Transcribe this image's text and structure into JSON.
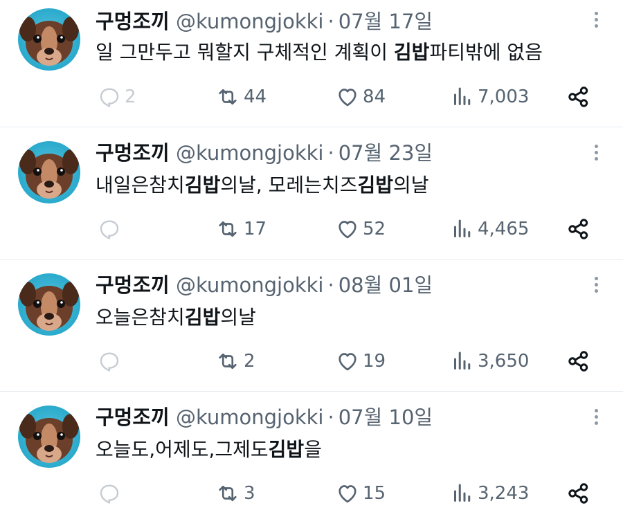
{
  "colors": {
    "text_primary": "#0f1419",
    "text_secondary": "#566370",
    "divider": "#e6ebee",
    "avatar_bg": "#2fb7d9"
  },
  "icons": {
    "reply": "reply-icon",
    "retweet": "retweet-icon",
    "like": "heart-icon",
    "views": "views-icon",
    "share": "share-icon",
    "more": "more-icon"
  },
  "tweets": [
    {
      "name": "구멍조끼",
      "handle": "@kumongjokki",
      "separator": "·",
      "date": "07월 17일",
      "body_before": "일 그만두고 뭐할지 구체적인 계획이 ",
      "body_bold": "김밥",
      "body_after": "파티밖에 없음",
      "replies": "2",
      "retweets": "44",
      "likes": "84",
      "views": "7,003"
    },
    {
      "name": "구멍조끼",
      "handle": "@kumongjokki",
      "separator": "·",
      "date": "07월 23일",
      "body_before": "내일은참치",
      "body_bold": "김밥",
      "body_mid": "의날, 모레는치즈",
      "body_bold2": "김밥",
      "body_after": "의날",
      "replies": "",
      "retweets": "17",
      "likes": "52",
      "views": "4,465"
    },
    {
      "name": "구멍조끼",
      "handle": "@kumongjokki",
      "separator": "·",
      "date": "08월 01일",
      "body_before": "오늘은참치",
      "body_bold": "김밥",
      "body_after": "의날",
      "replies": "",
      "retweets": "2",
      "likes": "19",
      "views": "3,650"
    },
    {
      "name": "구멍조끼",
      "handle": "@kumongjokki",
      "separator": "·",
      "date": "07월 10일",
      "body_before": "오늘도,어제도,그제도",
      "body_bold": "김밥",
      "body_after": "을",
      "replies": "",
      "retweets": "3",
      "likes": "15",
      "views": "3,243"
    }
  ]
}
